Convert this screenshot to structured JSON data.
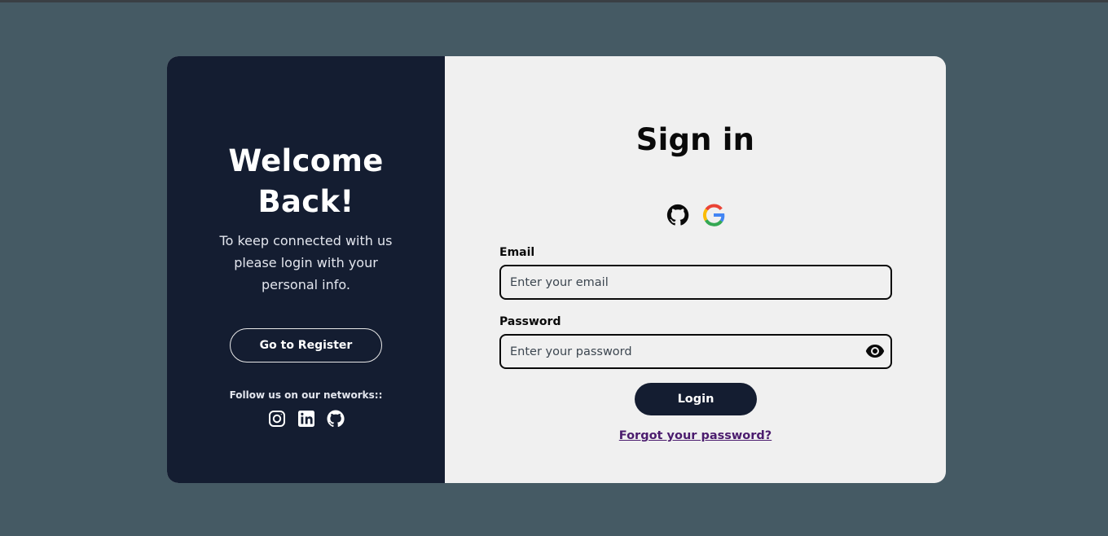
{
  "colors": {
    "page_background": "#455a64",
    "panel_dark": "#141d31",
    "panel_light": "#f0f0f0",
    "link": "#4b1c6e"
  },
  "welcome": {
    "title_line1": "Welcome",
    "title_line2": "Back!",
    "subtitle": "To keep connected with us please login with your personal info.",
    "register_label": "Go to Register",
    "follow_label": "Follow us on our networks::",
    "social_icons": [
      "instagram-icon",
      "linkedin-icon",
      "github-icon"
    ]
  },
  "signin": {
    "title": "Sign in",
    "oauth_icons": [
      "github-icon",
      "google-icon"
    ],
    "email": {
      "label": "Email",
      "placeholder": "Enter your email",
      "value": ""
    },
    "password": {
      "label": "Password",
      "placeholder": "Enter your password",
      "value": "",
      "toggle_icon": "eye-icon"
    },
    "login_label": "Login",
    "forgot_label": "Forgot your password?"
  }
}
